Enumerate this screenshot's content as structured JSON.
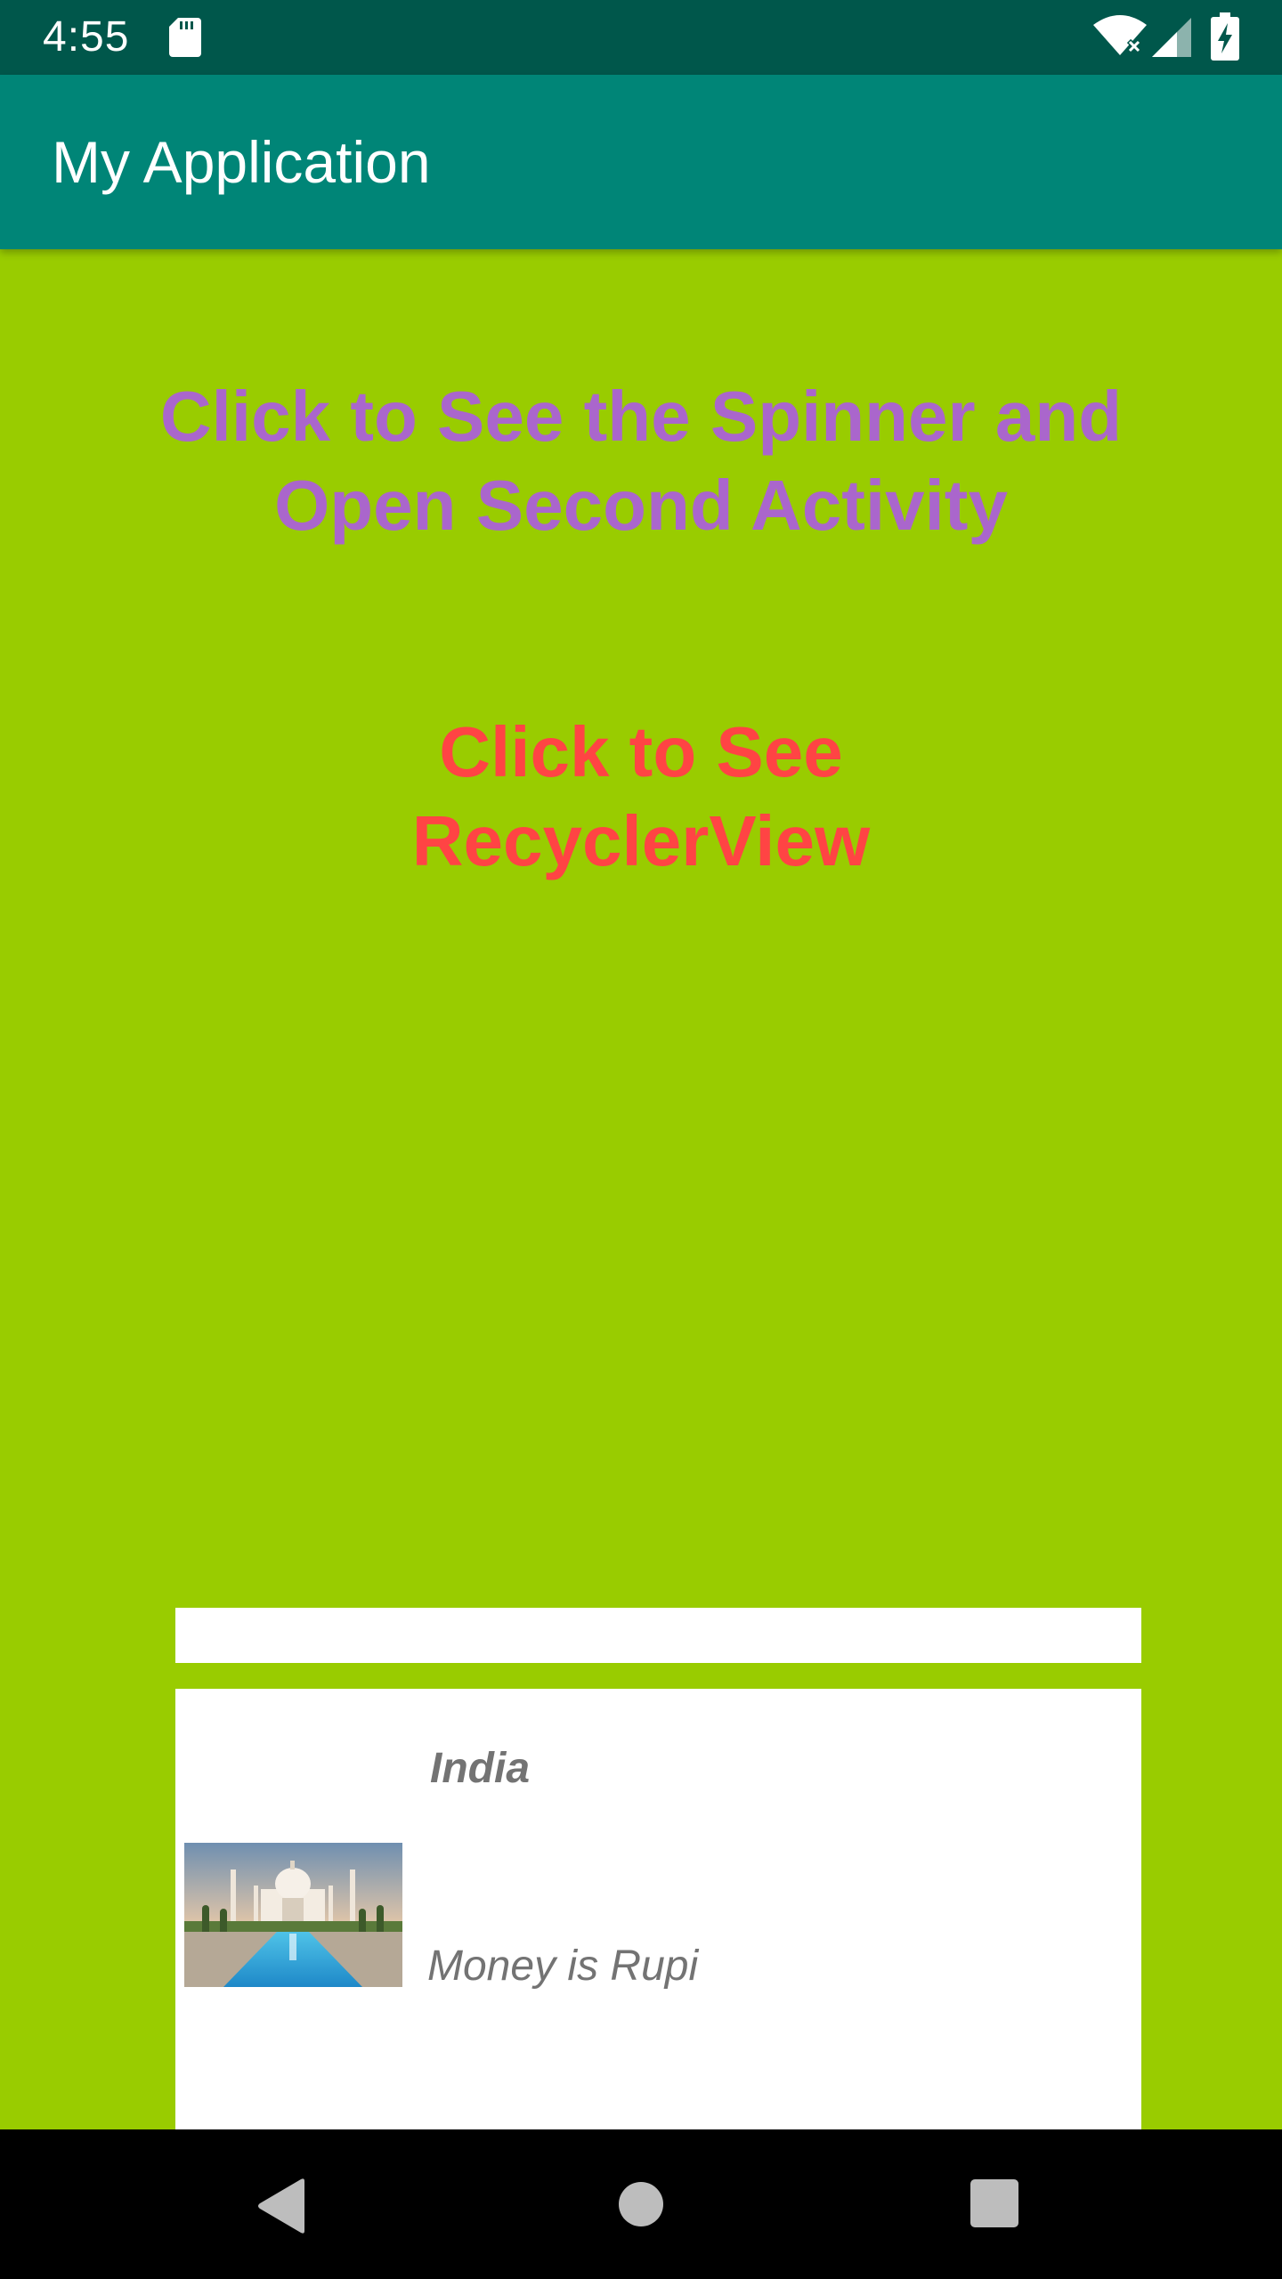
{
  "status_bar": {
    "time": "4:55",
    "icons": [
      "sd-card-icon",
      "wifi-icon",
      "cell-signal-icon",
      "battery-charging-icon"
    ]
  },
  "app_bar": {
    "title": "My Application"
  },
  "main": {
    "spinner_link": {
      "line1": "Click to See the Spinner and",
      "line2": "Open Second Activity"
    },
    "recycler_link": {
      "line1": "Click to See",
      "line2": "RecyclerView"
    },
    "recycler_items": [
      {
        "title": "India",
        "description": "Money is Rupi",
        "image": "taj-mahal-photo"
      }
    ]
  },
  "nav_bar": {
    "icons": [
      "back-icon",
      "home-icon",
      "recents-icon"
    ]
  },
  "colors": {
    "background": "#99cc00",
    "status_bar": "#00574b",
    "app_bar": "#008577",
    "spinner_link": "#aa66cc",
    "recycler_link": "#ff4444",
    "card": "#ffffff",
    "card_text": "#737373"
  }
}
